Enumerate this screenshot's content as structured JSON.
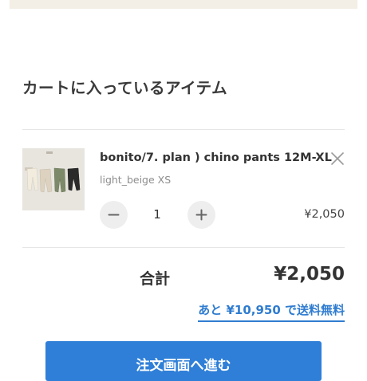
{
  "cart": {
    "heading": "カートに入っているアイテム"
  },
  "item": {
    "name": "bonito/7. plan ) chino pants 12M-XL",
    "variant": "light_beige XS",
    "quantity": "1",
    "price": "¥2,050",
    "thumbnail": "product-photo-chino-pants"
  },
  "summary": {
    "total_label": "合計",
    "total_value": "¥2,050",
    "free_shipping_note": "あと ¥10,950 で送料無料"
  },
  "checkout": {
    "label": "注文画面へ進む"
  },
  "colors": {
    "accent": "#2f7fd8",
    "link": "#2f7cd0",
    "banner": "#f3eee6",
    "stepper_bg": "#eeeeee"
  },
  "icons": {
    "remove": "close-icon",
    "decrement": "minus-icon",
    "increment": "plus-icon"
  }
}
